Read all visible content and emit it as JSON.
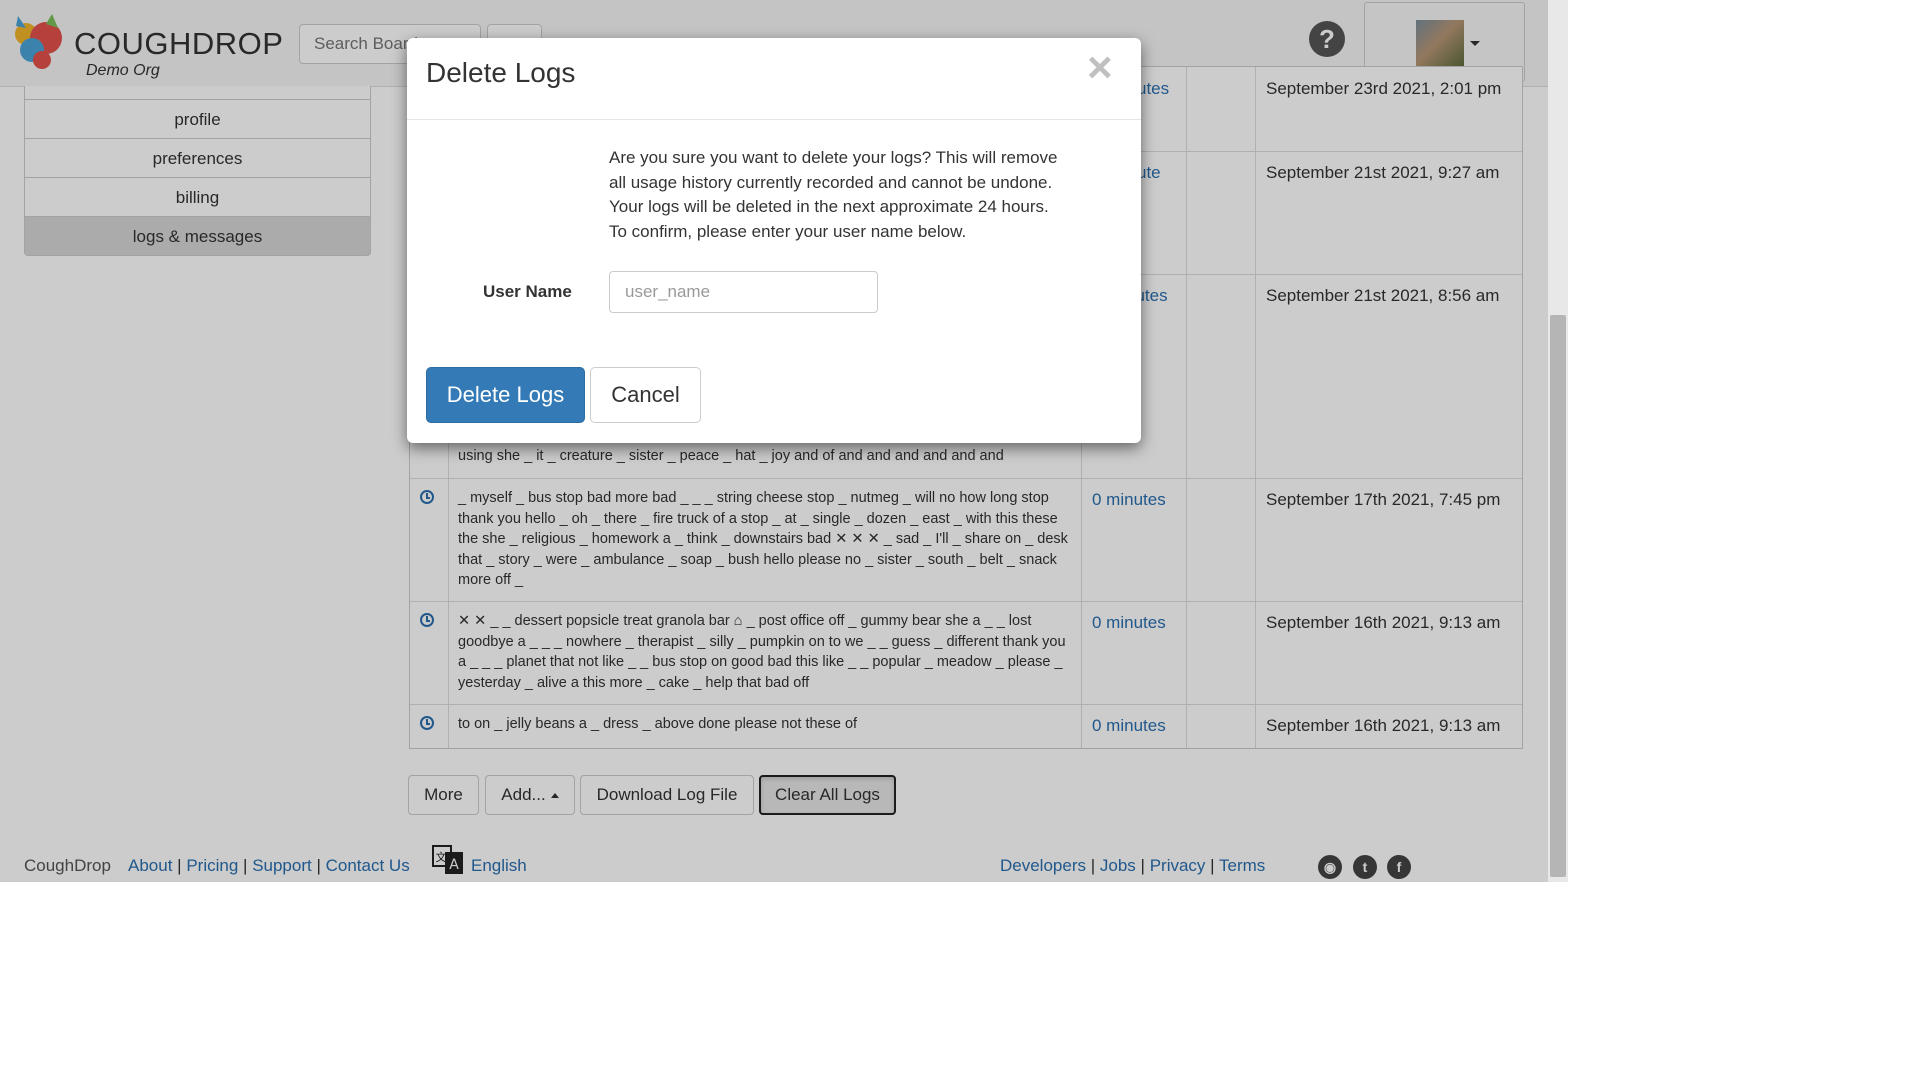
{
  "header": {
    "brand": "COUGHDROP",
    "org": "Demo Org",
    "search_placeholder": "Search Boards",
    "help_glyph": "?",
    "logo_icon": "coughdrop-logo-icon",
    "search_icon": "search-icon",
    "help_icon": "question-circle-icon",
    "avatar_icon": "user-avatar"
  },
  "sidebar": {
    "items": [
      {
        "label": "profile"
      },
      {
        "label": "preferences"
      },
      {
        "label": "billing"
      },
      {
        "label": "logs & messages",
        "active": true
      }
    ]
  },
  "logs": {
    "rows": [
      {
        "text": "",
        "duration": "",
        "date": "September 23rd 2021, 2:01 pm"
      },
      {
        "text": "",
        "duration": "",
        "date": "September 21st 2021, 9:27 am"
      },
      {
        "text": "using she _ it _ creature _ sister _ peace _ hat _ joy and of and and and and and and",
        "duration": "",
        "date": "September 21st 2021, 8:56 am"
      },
      {
        "text": "_ myself _ bus stop bad more bad _ _ _ string cheese stop _ nutmeg _ will no how long stop thank you hello _ oh _ there _ fire truck of a stop _ at _ single _ dozen _ east _ with this these the she _ religious _ homework a _ think _ downstairs bad ✕ ✕ ✕ _ sad _ I'll _ share on _ desk that _ story _ were _ ambulance _ soap _ bush hello please no _ sister _ south _ belt _ snack more off _",
        "duration": "0 minutes",
        "date": "September 17th 2021, 7:45 pm"
      },
      {
        "text": "✕ ✕ _ _ dessert popsicle treat granola bar ⌂ _ post office off _ gummy bear she a _ _ lost goodbye a _ _ _ nowhere _ therapist _ silly _ pumpkin on to we _ _ guess _ different thank you a _ _ _ planet that not like _ _ bus stop on good bad this like _ _ popular _ meadow _ please _ yesterday _ alive a this more _ cake _ help that bad off",
        "duration": "0 minutes",
        "date": "September 16th 2021, 9:13 am"
      },
      {
        "text": "to on _ jelly beans a _ dress _ above done please not these of",
        "duration": "0 minutes",
        "date": "September 16th 2021, 9:13 am"
      }
    ],
    "partial_durations": [
      "utes",
      "ute",
      "nutes"
    ]
  },
  "actions": {
    "more": "More",
    "add": "Add...",
    "download": "Download Log File",
    "clear": "Clear All Logs"
  },
  "footer": {
    "brand": "CoughDrop",
    "about": "About",
    "pricing": "Pricing",
    "support": "Support",
    "contact": "Contact Us",
    "language": "English",
    "developers": "Developers",
    "jobs": "Jobs",
    "privacy": "Privacy",
    "terms": "Terms",
    "social_icons": [
      "rss-icon",
      "twitter-icon",
      "facebook-icon"
    ]
  },
  "modal": {
    "title": "Delete Logs",
    "close_glyph": "×",
    "description": "Are you sure you want to delete your logs? This will remove all usage history currently recorded and cannot be undone. Your logs will be deleted in the next approximate 24 hours. To confirm, please enter your user name below.",
    "field_label": "User Name",
    "field_placeholder": "user_name",
    "field_value": "",
    "confirm_label": "Delete Logs",
    "cancel_label": "Cancel"
  },
  "colors": {
    "primary": "#337ab7",
    "link": "#2a6fb0",
    "overlay": "rgba(0,0,0,0.2)"
  }
}
